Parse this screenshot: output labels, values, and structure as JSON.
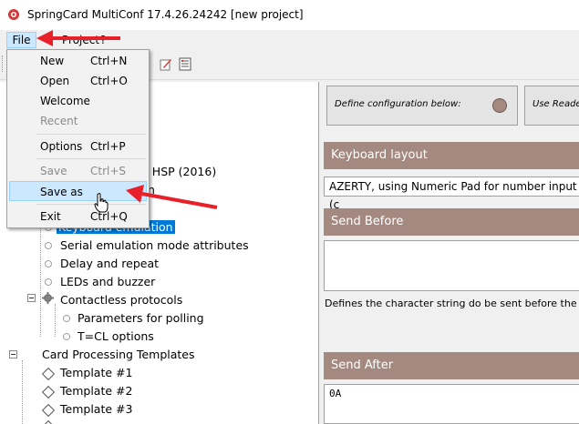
{
  "window": {
    "title": "SpringCard MultiConf 17.4.26.24242 [new project]"
  },
  "menubar": {
    "file": "File",
    "project": "Project",
    "help": "?"
  },
  "file_menu": {
    "new": {
      "label": "New",
      "shortcut": "Ctrl+N"
    },
    "open": {
      "label": "Open",
      "shortcut": "Ctrl+O"
    },
    "welcome": {
      "label": "Welcome"
    },
    "recent": {
      "label": "Recent"
    },
    "options": {
      "label": "Options",
      "shortcut": "Ctrl+P"
    },
    "save": {
      "label": "Save",
      "shortcut": "Ctrl+S"
    },
    "save_as": {
      "label": "Save as"
    },
    "exit": {
      "label": "Exit",
      "shortcut": "Ctrl+Q"
    }
  },
  "tree": {
    "partial_hsp": "er HSP (2016)",
    "partial_n": "n",
    "keyboard_emulation": "Keyboard emulation",
    "serial_emulation": "Serial emulation mode attributes",
    "delay_repeat": "Delay and repeat",
    "leds_buzzer": "LEDs and buzzer",
    "contactless_protocols": "Contactless protocols",
    "parameters_polling": "Parameters for polling",
    "tcl_options": "T=CL options",
    "card_processing": "Card Processing Templates",
    "templates": [
      "Template #1",
      "Template #2",
      "Template #3"
    ]
  },
  "right": {
    "define_text": "Define configuration below:",
    "use_reader": "Use Reader",
    "keyboard_layout_header": "Keyboard layout",
    "keyboard_layout_value": "AZERTY, using Numeric Pad for number input (c",
    "send_before_header": "Send Before",
    "send_before_value": "",
    "send_before_desc": "Defines the character string do be sent before the act",
    "send_after_header": "Send After",
    "send_after_value": "0A"
  },
  "colors": {
    "accent": "#a3897f",
    "selection": "#0078d7",
    "arrow": "#e8202a"
  }
}
